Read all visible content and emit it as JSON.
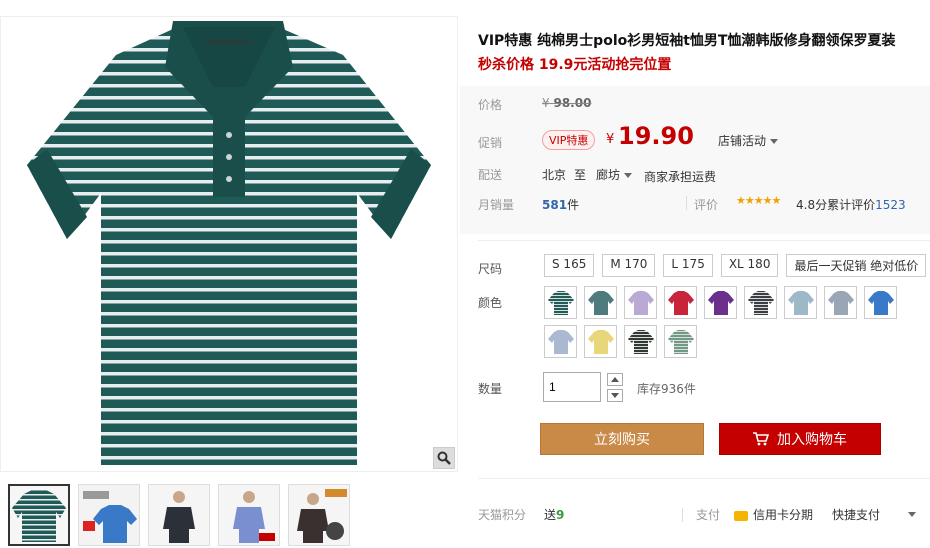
{
  "product": {
    "title": "VIP特惠 纯棉男士polo衫男短袖t恤男T恤潮韩版修身翻领保罗夏装",
    "subtitle": "秒杀价格 19.9元活动抢完位置"
  },
  "price": {
    "label": "价格",
    "currency": "¥",
    "original": "98.00",
    "promo_label": "促销",
    "vip_badge": "VIP特惠",
    "current": "19.90",
    "store_promo": "店铺活动"
  },
  "shipping": {
    "label": "配送",
    "from": "北京",
    "to_word": "至",
    "to": "廊坊",
    "note": "商家承担运费"
  },
  "sales": {
    "label": "月销量",
    "count": "581",
    "unit": "件",
    "review_label": "评价",
    "stars": "★★★★★",
    "rating": "4.8分",
    "review_text": "累计评价",
    "review_count": "1523"
  },
  "size": {
    "label": "尺码",
    "options": [
      "S 165",
      "M 170",
      "L 175",
      "XL 180",
      "最后一天促销 绝对低价"
    ]
  },
  "color": {
    "label": "颜色",
    "swatches": [
      "#1f5f5a",
      "#4f7a7e",
      "#b9a9d4",
      "#c8243a",
      "#6b2f8c",
      "#3a3f45",
      "#9fb8c8",
      "#9aa6b5",
      "#3a78c8",
      "#aab8d0",
      "#e8d77a",
      "#2f3a33",
      "#6f9a86"
    ]
  },
  "quantity": {
    "label": "数量",
    "value": "1",
    "stock": "库存936件"
  },
  "actions": {
    "buy_now": "立刻购买",
    "add_to_cart": "加入购物车"
  },
  "bottom": {
    "points_label": "天猫积分",
    "points_prefix": "送",
    "points_value": "9",
    "pay_label": "支付",
    "credit": "信用卡分期",
    "quick_pay": "快捷支付"
  },
  "icons": [
    "magnifier-icon",
    "cart-icon",
    "chevron-down-icon",
    "credit-card-icon"
  ]
}
